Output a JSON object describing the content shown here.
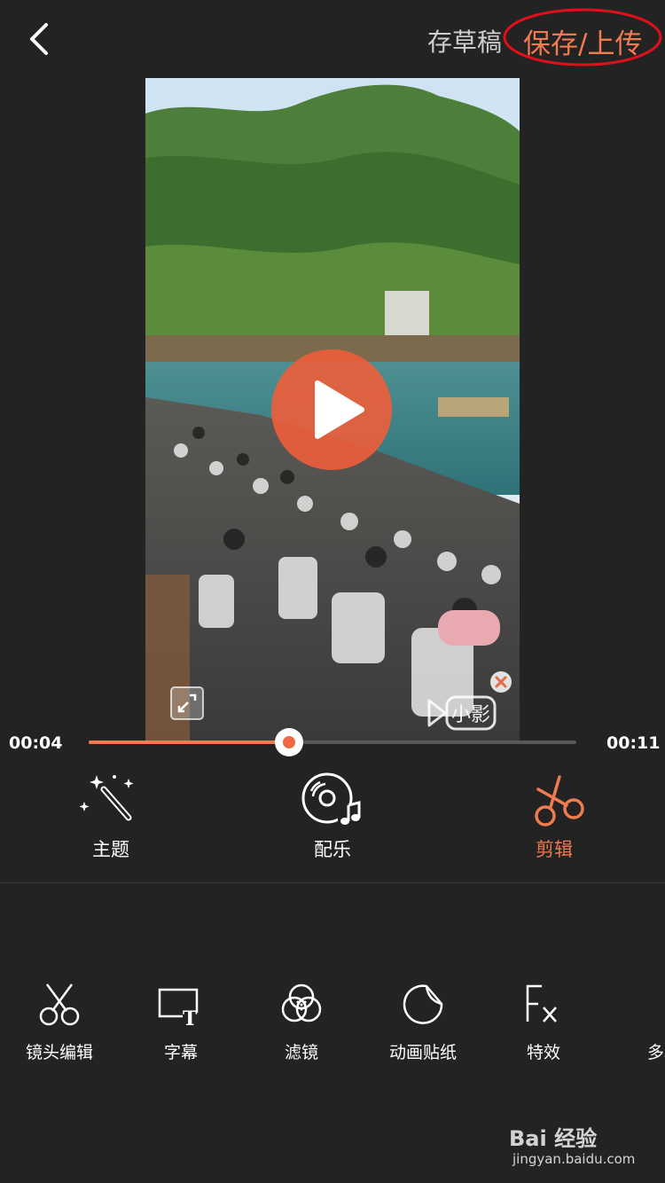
{
  "header": {
    "back_icon": "chevron-left-icon",
    "draft_label": "存草稿",
    "save_label": "保存/上传",
    "accent_color": "#ef7b4f"
  },
  "player": {
    "play_icon": "play-icon",
    "current_time": "00:04",
    "total_time": "00:11",
    "progress": 0.41,
    "watermark_text": "小影"
  },
  "main_tabs": [
    {
      "label": "主题",
      "icon": "magic-wand-icon",
      "active": false
    },
    {
      "label": "配乐",
      "icon": "music-disc-icon",
      "active": false
    },
    {
      "label": "剪辑",
      "icon": "scissors-icon",
      "active": true
    }
  ],
  "tools": [
    {
      "label": "镜头编辑",
      "icon": "scissors-icon"
    },
    {
      "label": "字幕",
      "icon": "subtitle-icon"
    },
    {
      "label": "滤镜",
      "icon": "filter-icon"
    },
    {
      "label": "动画贴纸",
      "icon": "sticker-icon"
    },
    {
      "label": "特效",
      "icon": "fx-icon"
    },
    {
      "label": "多段",
      "icon": "multi-segment-icon"
    }
  ],
  "watermark": {
    "brand": "Bai 经验",
    "url": "jingyan.baidu.com"
  }
}
